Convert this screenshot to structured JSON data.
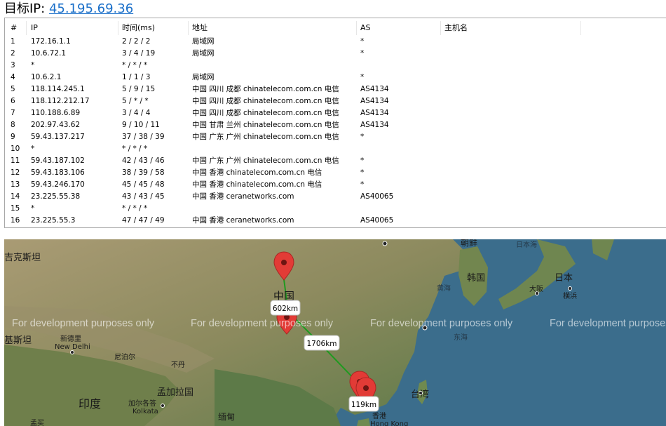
{
  "header": {
    "prefix": "目标IP: ",
    "ip": "45.195.69.36"
  },
  "table": {
    "columns": [
      "#",
      "IP",
      "时间(ms)",
      "地址",
      "AS",
      "主机名"
    ],
    "rows": [
      {
        "n": "1",
        "ip": "172.16.1.1",
        "time": "2 / 2 / 2",
        "addr": "局域网",
        "as": "*",
        "host": ""
      },
      {
        "n": "2",
        "ip": "10.6.72.1",
        "time": "3 / 4 / 19",
        "addr": "局域网",
        "as": "*",
        "host": ""
      },
      {
        "n": "3",
        "ip": "*",
        "time": "* / * / *",
        "addr": "",
        "as": "",
        "host": ""
      },
      {
        "n": "4",
        "ip": "10.6.2.1",
        "time": "1 / 1 / 3",
        "addr": "局域网",
        "as": "*",
        "host": ""
      },
      {
        "n": "5",
        "ip": "118.114.245.1",
        "time": "5 / 9 / 15",
        "addr": "中国 四川 成都 chinatelecom.com.cn 电信",
        "as": "AS4134",
        "host": ""
      },
      {
        "n": "6",
        "ip": "118.112.212.17",
        "time": "5 / * / *",
        "addr": "中国 四川 成都 chinatelecom.com.cn 电信",
        "as": "AS4134",
        "host": ""
      },
      {
        "n": "7",
        "ip": "110.188.6.89",
        "time": "3 / 4 / 4",
        "addr": "中国 四川 成都 chinatelecom.com.cn 电信",
        "as": "AS4134",
        "host": ""
      },
      {
        "n": "8",
        "ip": "202.97.43.62",
        "time": "9 / 10 / 11",
        "addr": "中国 甘肃 兰州 chinatelecom.com.cn 电信",
        "as": "AS4134",
        "host": ""
      },
      {
        "n": "9",
        "ip": "59.43.137.217",
        "time": "37 / 38 / 39",
        "addr": "中国 广东 广州 chinatelecom.com.cn 电信",
        "as": "*",
        "host": ""
      },
      {
        "n": "10",
        "ip": "*",
        "time": "* / * / *",
        "addr": "",
        "as": "",
        "host": ""
      },
      {
        "n": "11",
        "ip": "59.43.187.102",
        "time": "42 / 43 / 46",
        "addr": "中国 广东 广州 chinatelecom.com.cn 电信",
        "as": "*",
        "host": ""
      },
      {
        "n": "12",
        "ip": "59.43.183.106",
        "time": "38 / 39 / 58",
        "addr": "中国 香港 chinatelecom.com.cn 电信",
        "as": "*",
        "host": ""
      },
      {
        "n": "13",
        "ip": "59.43.246.170",
        "time": "45 / 45 / 48",
        "addr": "中国 香港 chinatelecom.com.cn 电信",
        "as": "*",
        "host": ""
      },
      {
        "n": "14",
        "ip": "23.225.55.38",
        "time": "43 / 43 / 45",
        "addr": "中国 香港 ceranetworks.com",
        "as": "AS40065",
        "host": ""
      },
      {
        "n": "15",
        "ip": "*",
        "time": "* / * / *",
        "addr": "",
        "as": "",
        "host": ""
      },
      {
        "n": "16",
        "ip": "23.225.55.3",
        "time": "47 / 47 / 49",
        "addr": "中国 香港 ceranetworks.com",
        "as": "AS40065",
        "host": ""
      }
    ]
  },
  "map": {
    "watermark": "For development purposes only",
    "distances": [
      "602km",
      "1706km",
      "119km"
    ],
    "labels": {
      "kazakhstan": "吉克斯坦",
      "pakistan": "基斯坦",
      "new_delhi_cn": "新德里",
      "new_delhi_en": "New Delhi",
      "nepal": "尼泊尔",
      "bhutan": "不丹",
      "bangladesh": "孟加拉国",
      "india": "印度",
      "kolkata_cn": "加尔各答",
      "kolkata_en": "Kolkata",
      "myanmar": "缅甸",
      "mumbai": "孟买",
      "china": "中国",
      "north_korea": "朝鲜",
      "south_korea": "韩国",
      "sea_of_japan": "日本海",
      "japan": "日本",
      "osaka": "大阪",
      "yokohama": "横浜",
      "yellow_sea": "黄海",
      "east_sea": "东海",
      "taiwan": "台湾",
      "hong_kong_cn": "香港",
      "hong_kong_en": "Hong Kong"
    },
    "colors": {
      "route": "#1f9a1f",
      "pin": "#e23b36",
      "water": "#3b6d8c"
    }
  }
}
